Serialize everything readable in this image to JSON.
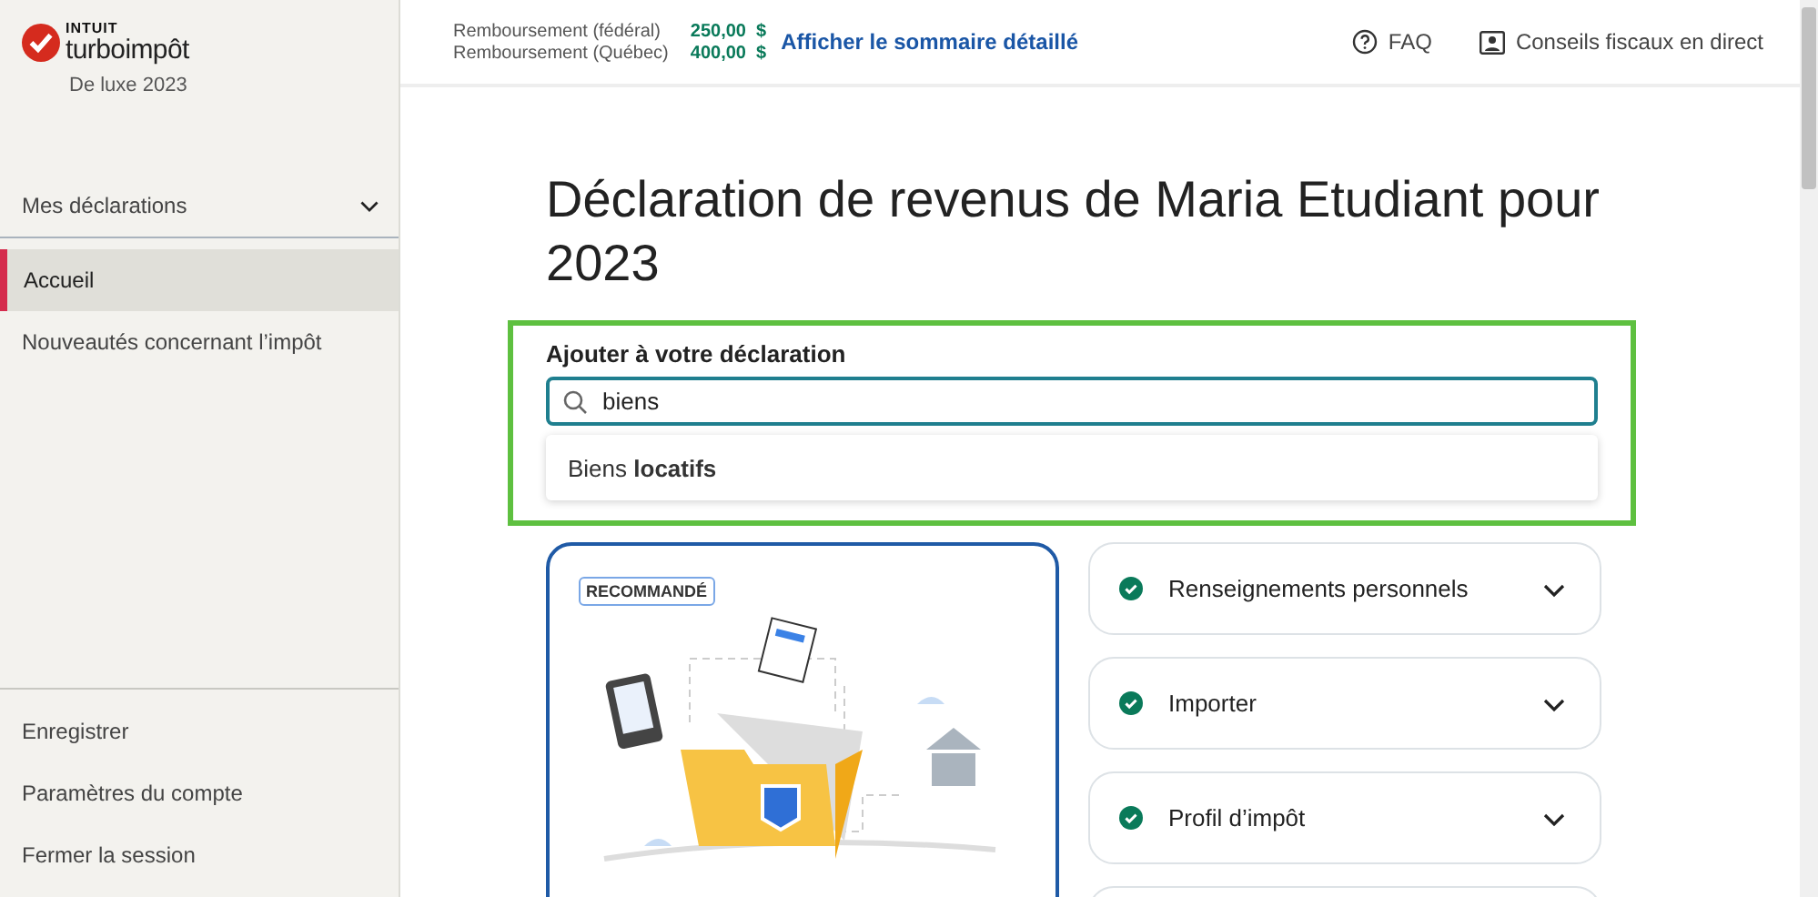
{
  "brand": {
    "company": "INTUIT",
    "product": "turboimpôt",
    "edition": "De luxe 2023"
  },
  "sidebar": {
    "group": {
      "label": "Mes déclarations",
      "expanded": false
    },
    "items": [
      {
        "label": "Accueil",
        "selected": true
      },
      {
        "label": "Nouveautés concernant l’impôt",
        "selected": false
      }
    ],
    "footer_items": [
      "Enregistrer",
      "Paramètres du compte",
      "Fermer la session"
    ]
  },
  "header": {
    "refunds": [
      {
        "label": "Remboursement (fédéral)",
        "amount": "250,00  $"
      },
      {
        "label": "Remboursement (Québec)",
        "amount": "400,00  $"
      }
    ],
    "summary_link": "Afficher le sommaire détaillé",
    "links": [
      {
        "kind": "help",
        "label": "FAQ"
      },
      {
        "kind": "advice",
        "label": "Conseils fiscaux en direct"
      }
    ]
  },
  "title": "Déclaration de revenus de Maria Etudiant pour 2023",
  "add_section": {
    "label": "Ajouter à votre déclaration",
    "search_value": "biens",
    "suggestions": [
      "Biens **locatifs**"
    ]
  },
  "recommended_card": {
    "badge": "RECOMMANDÉ"
  },
  "sections": [
    {
      "label": "Renseignements personnels",
      "done": true,
      "expanded": false
    },
    {
      "label": "Importer",
      "done": true,
      "expanded": false
    },
    {
      "label": "Profil d’impôt",
      "done": true,
      "expanded": false
    }
  ]
}
